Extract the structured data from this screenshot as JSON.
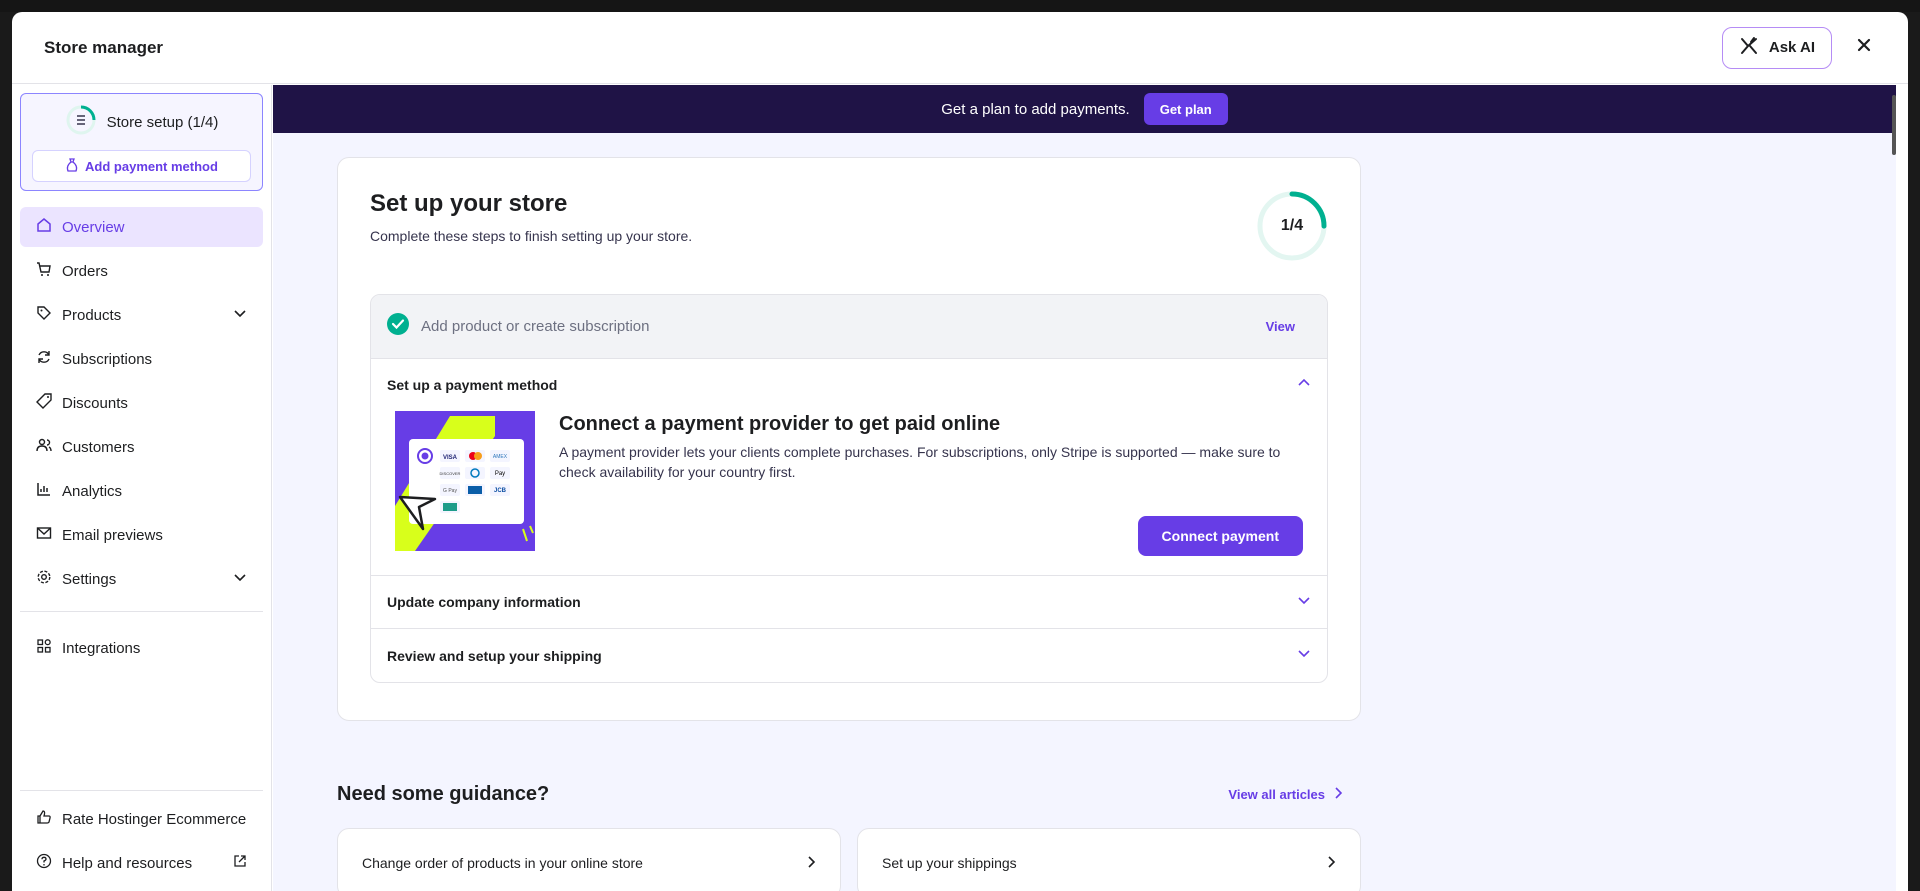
{
  "header": {
    "title": "Store manager",
    "ask_ai_label": "Ask AI"
  },
  "sidebar": {
    "setup": {
      "label": "Store setup (1/4)",
      "add_payment_label": "Add payment method"
    },
    "items": [
      {
        "label": "Overview",
        "icon": "home-icon"
      },
      {
        "label": "Orders",
        "icon": "cart-icon"
      },
      {
        "label": "Products",
        "icon": "tag-icon"
      },
      {
        "label": "Subscriptions",
        "icon": "refresh-icon"
      },
      {
        "label": "Discounts",
        "icon": "discount-tag-icon"
      },
      {
        "label": "Customers",
        "icon": "users-icon"
      },
      {
        "label": "Analytics",
        "icon": "bar-chart-icon"
      },
      {
        "label": "Email previews",
        "icon": "mail-icon"
      },
      {
        "label": "Settings",
        "icon": "gear-icon"
      },
      {
        "label": "Integrations",
        "icon": "grid-icon"
      }
    ],
    "bottom": [
      {
        "label": "Rate Hostinger Ecommerce",
        "icon": "thumbs-up-icon"
      },
      {
        "label": "Help and resources",
        "icon": "help-circle-icon"
      }
    ]
  },
  "banner": {
    "text": "Get a plan to add payments.",
    "button_label": "Get plan"
  },
  "setup_card": {
    "title": "Set up your store",
    "subtitle": "Complete these steps to finish setting up your store.",
    "progress_text": "1/4",
    "progress_fraction": 0.25,
    "steps": {
      "done": {
        "label": "Add product or create subscription",
        "link": "View"
      },
      "open": {
        "label": "Set up a payment method",
        "body_title": "Connect a payment provider to get paid online",
        "body_desc": "A payment provider lets your clients complete purchases. For subscriptions, only Stripe is supported — make sure to check availability for your country first.",
        "button_label": "Connect payment"
      },
      "company": {
        "label": "Update company information"
      },
      "shipping": {
        "label": "Review and setup your shipping"
      }
    }
  },
  "guidance": {
    "title": "Need some guidance?",
    "view_all": "View all articles",
    "articles": [
      {
        "label": "Change order of products in your online store"
      },
      {
        "label": "Set up your shippings"
      }
    ]
  },
  "colors": {
    "accent": "#673de6",
    "banner_bg": "#1f1346",
    "success": "#00b090",
    "illustration_bg": "#673de6",
    "illustration_lime": "#d8ff1b"
  }
}
